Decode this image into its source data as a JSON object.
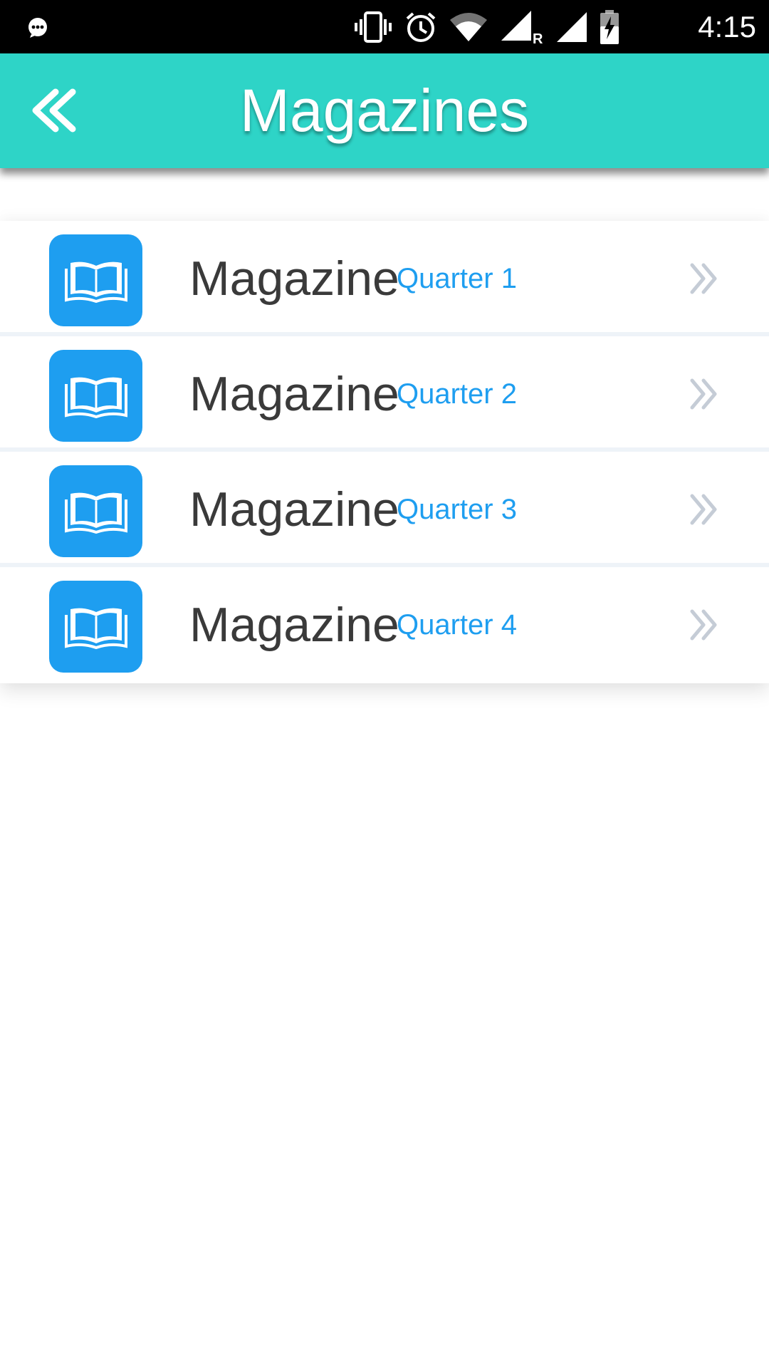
{
  "status_bar": {
    "time": "4:15",
    "icons": [
      "chat-bubble-icon",
      "vibrate-icon",
      "alarm-icon",
      "wifi-icon",
      "signal-r-icon",
      "signal-icon",
      "battery-charging-icon"
    ]
  },
  "header": {
    "title": "Magazines",
    "back_icon": "double-chevron-left-icon",
    "background_color": "#2ed4c7"
  },
  "list": {
    "items": [
      {
        "title": "Magazine",
        "subtitle": "Quarter 1",
        "icon": "open-book-icon",
        "arrow_icon": "double-chevron-right-icon"
      },
      {
        "title": "Magazine",
        "subtitle": "Quarter 2",
        "icon": "open-book-icon",
        "arrow_icon": "double-chevron-right-icon"
      },
      {
        "title": "Magazine",
        "subtitle": "Quarter 3",
        "icon": "open-book-icon",
        "arrow_icon": "double-chevron-right-icon"
      },
      {
        "title": "Magazine",
        "subtitle": "Quarter 4",
        "icon": "open-book-icon",
        "arrow_icon": "double-chevron-right-icon"
      }
    ],
    "icon_color": "#1e9ef0",
    "subtitle_color": "#1e9ef0"
  }
}
